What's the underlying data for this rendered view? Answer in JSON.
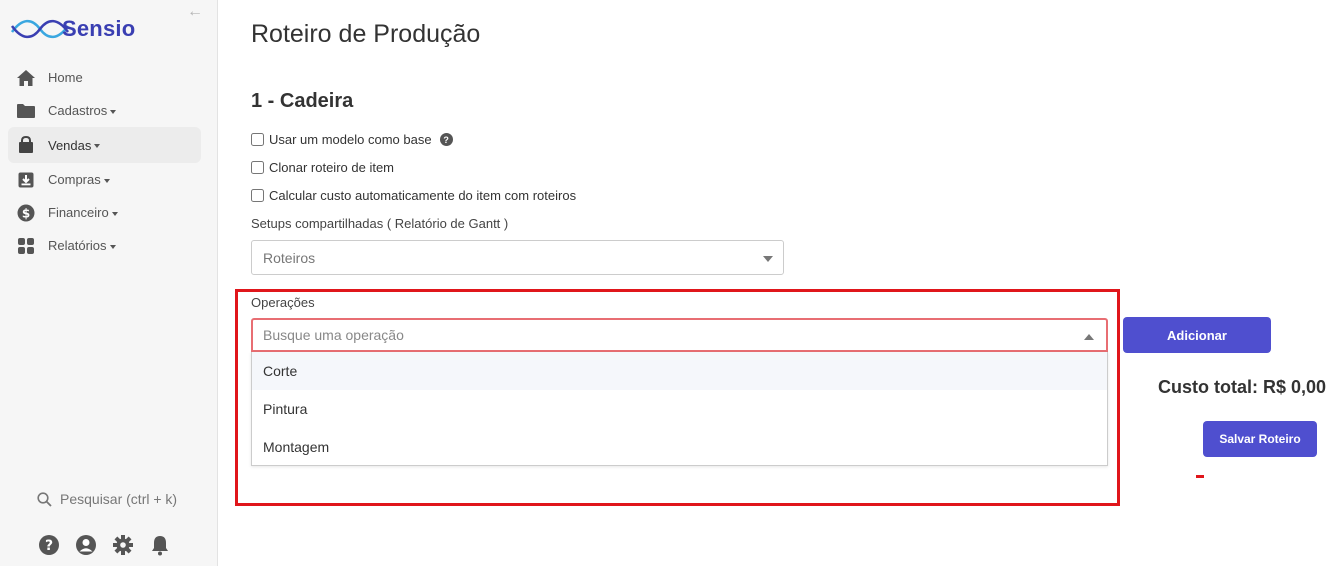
{
  "brand": {
    "name": "Sensio",
    "color": "#3a3fb2"
  },
  "sidebar": {
    "collapse_icon": "arrow-left-icon",
    "items": [
      {
        "label": "Home",
        "icon": "home-icon",
        "dropdown": false
      },
      {
        "label": "Cadastros",
        "icon": "folder-icon",
        "dropdown": true
      },
      {
        "label": "Vendas",
        "icon": "bag-icon",
        "dropdown": true,
        "active": true
      },
      {
        "label": "Compras",
        "icon": "download-box-icon",
        "dropdown": true
      },
      {
        "label": "Financeiro",
        "icon": "dollar-icon",
        "dropdown": true
      },
      {
        "label": "Relatórios",
        "icon": "grid-icon",
        "dropdown": true
      }
    ],
    "search_label": "Pesquisar (ctrl + k)",
    "bottom_icons": [
      "help-icon",
      "user-icon",
      "gear-icon",
      "bell-icon"
    ]
  },
  "main": {
    "title": "Roteiro de Produção",
    "section_title": "1 - Cadeira",
    "checkboxes": [
      {
        "label": "Usar um modelo como base",
        "checked": false,
        "help": true
      },
      {
        "label": "Clonar roteiro de item",
        "checked": false
      },
      {
        "label": "Calcular custo automaticamente do item com roteiros",
        "checked": false
      }
    ],
    "setup_label": "Setups compartilhadas ( Relatório de Gantt )",
    "setup_select_value": "Roteiros",
    "operations": {
      "label": "Operações",
      "placeholder": "Busque uma operação",
      "options": [
        "Corte",
        "Pintura",
        "Montagem"
      ]
    },
    "add_button": "Adicionar",
    "total_label": "Custo total: R$ 0,00",
    "save_button": "Salvar Roteiro"
  },
  "colors": {
    "primary_button": "#4f4fcf",
    "highlight": "#e0161b"
  }
}
